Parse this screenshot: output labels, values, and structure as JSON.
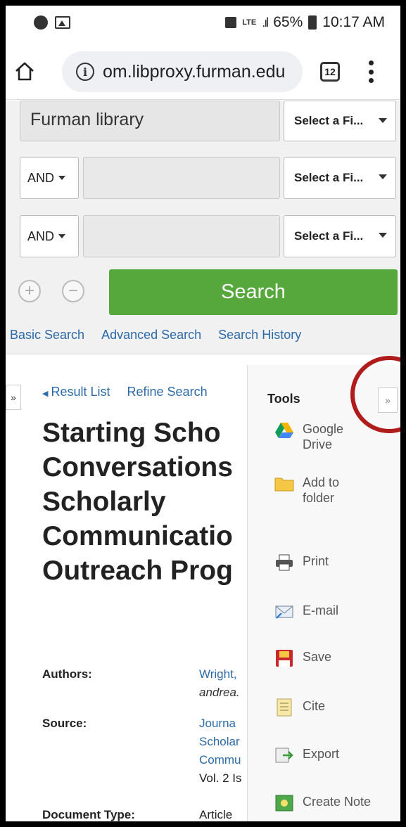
{
  "status_bar": {
    "battery": "65%",
    "time": "10:17 AM",
    "network": "LTE"
  },
  "browser": {
    "url": "om.libproxy.furman.edu",
    "tab_count": "12"
  },
  "search_form": {
    "main_query": "Furman library",
    "field_select_label": "Select a Fi...",
    "bool_label": "AND",
    "search_button": "Search",
    "links": [
      "Basic Search",
      "Advanced Search",
      "Search History"
    ]
  },
  "result": {
    "nav": {
      "result_list": "Result List",
      "refine_search": "Refine Search"
    },
    "title_lines": [
      "Starting Scho",
      "Conversations",
      "Scholarly",
      "Communicatio",
      "Outreach Prog"
    ],
    "fields": {
      "authors_label": "Authors:",
      "authors_value": "Wright,",
      "authors_email": "andrea.",
      "source_label": "Source:",
      "source_lines": [
        "Journa",
        "Scholar",
        "Commu"
      ],
      "source_vol": "Vol. 2 Is",
      "doctype_label": "Document Type:",
      "doctype_value": "Article"
    }
  },
  "tools": {
    "title": "Tools",
    "items": [
      {
        "label": "Google\nDrive",
        "icon": "google-drive-icon"
      },
      {
        "label": "Add to\nfolder",
        "icon": "folder-icon"
      },
      {
        "label": "Print",
        "icon": "printer-icon"
      },
      {
        "label": "E-mail",
        "icon": "email-icon"
      },
      {
        "label": "Save",
        "icon": "save-icon"
      },
      {
        "label": "Cite",
        "icon": "cite-icon"
      },
      {
        "label": "Export",
        "icon": "export-icon"
      },
      {
        "label": "Create Note",
        "icon": "note-icon"
      }
    ]
  },
  "colors": {
    "search_button": "#56a83c",
    "link": "#2c6aa8",
    "highlight_circle": "#b01c1c"
  }
}
